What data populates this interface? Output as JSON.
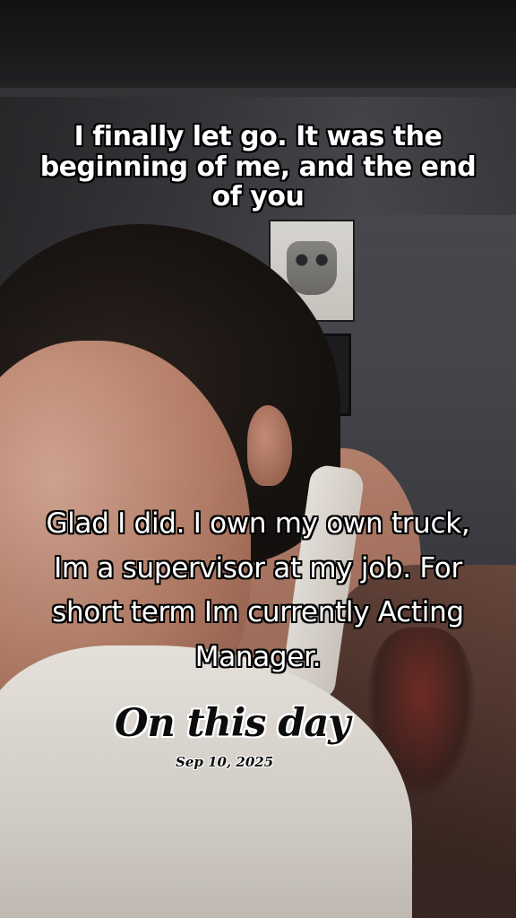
{
  "overlay": {
    "top_caption": "I finally let go. It was the beginning of me, and the end of you",
    "bottom_caption": "Glad I did. I own my own truck, Im a supervisor at my job. For short term Im currently Acting Manager.",
    "memory_title": "On this day",
    "memory_date": "Sep 10, 2025"
  }
}
